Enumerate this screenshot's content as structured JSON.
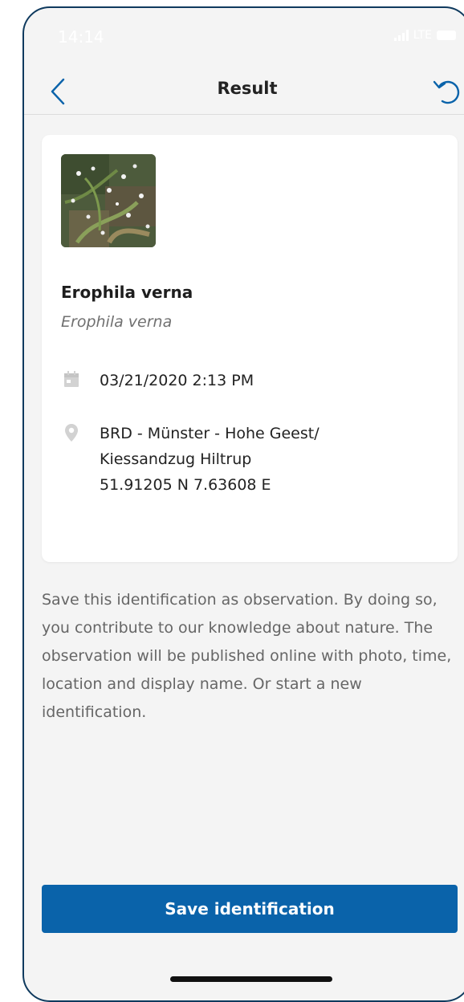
{
  "status_bar": {
    "time": "14:14",
    "network": "LTE"
  },
  "nav": {
    "title": "Result",
    "back_icon": "chevron-left-icon",
    "reset_icon": "undo-icon"
  },
  "result": {
    "common_name": "Erophila verna",
    "scientific_name": "Erophila verna",
    "datetime": "03/21/2020 2:13 PM",
    "location_lines": [
      "BRD - Münster - Hohe Geest/",
      "Kiessandzug Hiltrup",
      "51.91205 N 7.63608 E"
    ],
    "photo_icon": "plant-photo"
  },
  "description": "Save this identification as observation. By doing so, you contribute to our knowledge about nature. The observation will be published online with photo, time, location and display name. Or start a new identification.",
  "actions": {
    "save_label": "Save identification"
  },
  "colors": {
    "accent": "#0a63aa",
    "background": "#f4f4f4",
    "card": "#ffffff",
    "icon_muted": "#d2d2d2"
  }
}
